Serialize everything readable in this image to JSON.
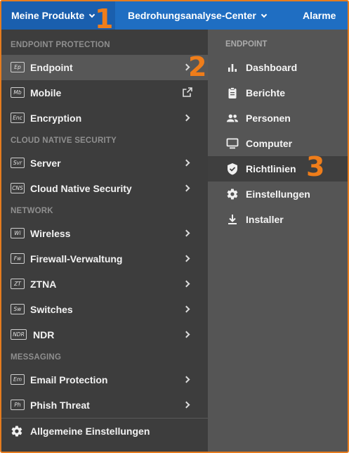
{
  "topbar": {
    "products_label": "Meine Produkte",
    "threat_center_label": "Bedrohungsanalyse-Center",
    "alarms_label": "Alarme"
  },
  "left_menu": {
    "sections": {
      "endpoint_protection": "ENDPOINT PROTECTION",
      "cloud_native_security": "CLOUD NATIVE SECURITY",
      "network": "NETWORK",
      "messaging": "MESSAGING"
    },
    "items": [
      {
        "badge": "Ep",
        "label": "Endpoint"
      },
      {
        "badge": "Mb",
        "label": "Mobile"
      },
      {
        "badge": "Enc",
        "label": "Encryption"
      },
      {
        "badge": "Svr",
        "label": "Server"
      },
      {
        "badge": "CNS",
        "label": "Cloud Native Security"
      },
      {
        "badge": "Wi",
        "label": "Wireless"
      },
      {
        "badge": "Fw",
        "label": "Firewall-Verwaltung"
      },
      {
        "badge": "ZT",
        "label": "ZTNA"
      },
      {
        "badge": "Sw",
        "label": "Switches"
      },
      {
        "badge": "NDR",
        "label": "NDR"
      },
      {
        "badge": "Em",
        "label": "Email Protection"
      },
      {
        "badge": "Ph",
        "label": "Phish Threat"
      }
    ],
    "general_settings_label": "Allgemeine Einstellungen"
  },
  "submenu": {
    "header": "ENDPOINT",
    "items": [
      {
        "icon": "bar-chart-icon",
        "label": "Dashboard"
      },
      {
        "icon": "clipboard-icon",
        "label": "Berichte"
      },
      {
        "icon": "people-icon",
        "label": "Personen"
      },
      {
        "icon": "monitor-icon",
        "label": "Computer"
      },
      {
        "icon": "shield-icon",
        "label": "Richtlinien"
      },
      {
        "icon": "gear-icon",
        "label": "Einstellungen"
      },
      {
        "icon": "download-icon",
        "label": "Installer"
      }
    ]
  },
  "annotations": {
    "step1": "1",
    "step2": "2",
    "step3": "3"
  },
  "colors": {
    "accent_orange": "#ef7d1a",
    "topbar_blue": "#1f6ec2",
    "menu_bg": "#3d3d3d",
    "submenu_bg": "#555555"
  }
}
